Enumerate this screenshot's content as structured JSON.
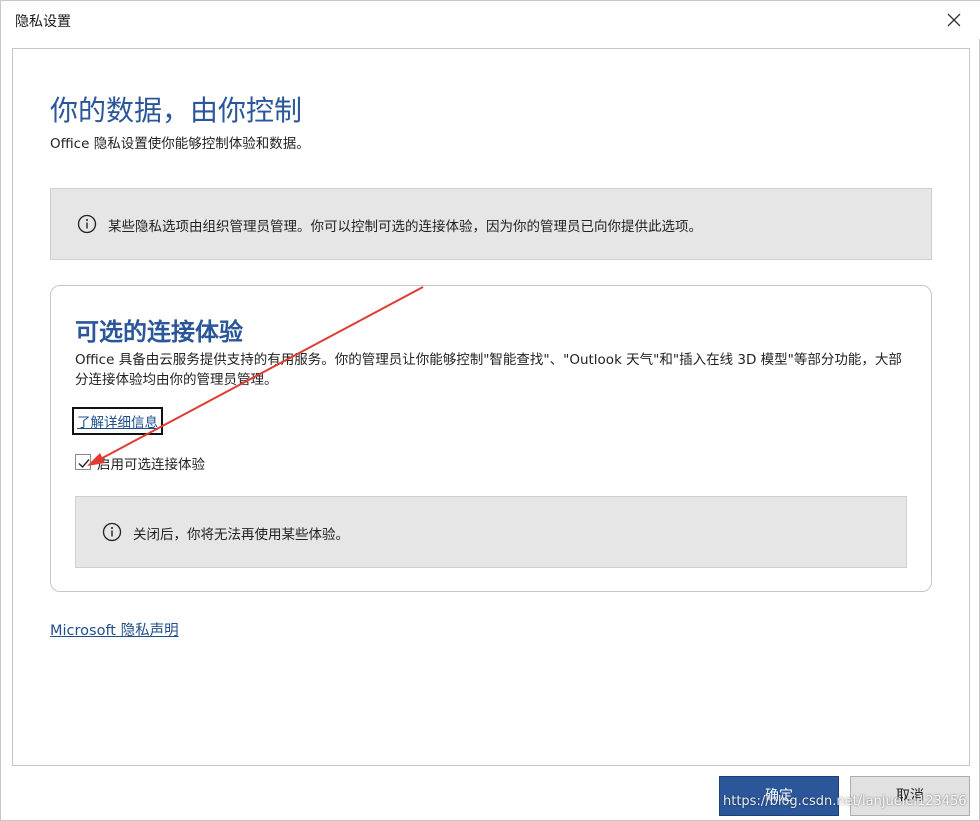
{
  "window": {
    "title": "隐私设置"
  },
  "header": {
    "title": "你的数据，由你控制",
    "subtitle": "Office 隐私设置使你能够控制体验和数据。"
  },
  "admin_notice": {
    "icon": "info-icon",
    "text": "某些隐私选项由组织管理员管理。你可以控制可选的连接体验，因为你的管理员已向你提供此选项。"
  },
  "optional_experiences": {
    "title": "可选的连接体验",
    "description": "Office 具备由云服务提供支持的有用服务。你的管理员让你能够控制\"智能查找\"、\"Outlook 天气\"和\"插入在线 3D 模型\"等部分功能，大部分连接体验均由你的管理员管理。",
    "learn_more": "了解详细信息",
    "checkbox_label": "启用可选连接体验",
    "checkbox_checked": true,
    "notice": {
      "icon": "info-icon",
      "text": "关闭后，你将无法再使用某些体验。"
    }
  },
  "privacy_link": "Microsoft 隐私声明",
  "buttons": {
    "ok": "确定",
    "cancel": "取消"
  },
  "watermark": "https://blog.csdn.net/lanjuelei123456",
  "colors": {
    "accent": "#2b579a",
    "link": "#1f4e8c",
    "notice_bg": "#e6e6e6",
    "annotation_arrow": "#e03c31"
  }
}
